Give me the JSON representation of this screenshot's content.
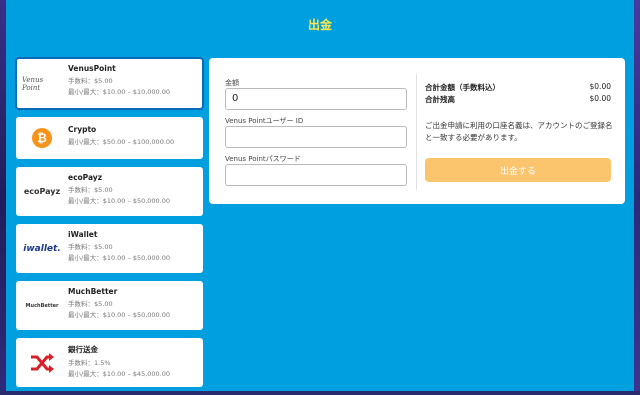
{
  "page": {
    "title": "出金"
  },
  "methods": [
    {
      "name": "VenusPoint",
      "logo_text": "Venus Point",
      "fee": "手数料：$5.00",
      "limits": "最小/最大：$10.00 – $10,000.00",
      "selected": true
    },
    {
      "name": "Crypto",
      "logo_text": "₿",
      "fee": "",
      "limits": "最小/最大：$50.00 – $100,000.00",
      "selected": false
    },
    {
      "name": "ecoPayz",
      "logo_text": "ecoPayz",
      "fee": "手数料：$5.00",
      "limits": "最小/最大：$10.00 – $50,000.00",
      "selected": false
    },
    {
      "name": "iWallet",
      "logo_text": "iwallet.",
      "fee": "手数料：$5.00",
      "limits": "最小/最大：$10.00 – $50,000.00",
      "selected": false
    },
    {
      "name": "MuchBetter",
      "logo_text": "MuchBetter",
      "fee": "手数料：$5.00",
      "limits": "最小/最大：$10.00 – $50,000.00",
      "selected": false
    },
    {
      "name": "銀行送金",
      "logo_text": "",
      "fee": "手数料：1.5%",
      "limits": "最小/最大：$10.00 – $45,000.00",
      "selected": false
    }
  ],
  "form": {
    "amount_label": "金額",
    "amount_value": "0",
    "user_id_label": "Venus Pointユーザー ID",
    "user_id_value": "",
    "password_label": "Venus Pointパスワード",
    "password_value": ""
  },
  "summary": {
    "total_label": "合計金額（手数料込）",
    "total_value": "$0.00",
    "balance_label": "合計残高",
    "balance_value": "$0.00",
    "notice": "ご出金申請に利用の口座名義は、アカウントのご登録名と一致する必要があります。",
    "withdraw_button": "出金する"
  },
  "colors": {
    "panel": "#00a0e0",
    "title": "#ffe84a",
    "button": "#fbc56e",
    "crypto": "#f7931a",
    "bank": "#d8202a",
    "ecopayz_green": "#8cc63f"
  }
}
